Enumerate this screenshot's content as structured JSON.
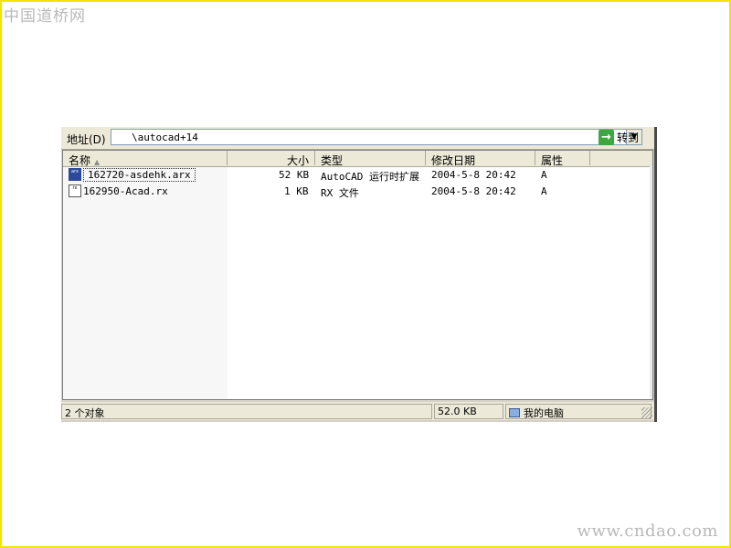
{
  "watermark": {
    "top": "中国道桥网",
    "bottom": "www.cndao.com"
  },
  "addressbar": {
    "label": "地址(D)",
    "path": "\\autocad+14",
    "go_label": "转到",
    "go_icon": "→",
    "dropdown_icon": "▼"
  },
  "columns": {
    "name": "名称",
    "size": "大小",
    "type": "类型",
    "modified": "修改日期",
    "attributes": "属性",
    "sort_indicator": "▲"
  },
  "files": [
    {
      "name": "162720-asdehk.arx",
      "size": "52 KB",
      "type": "AutoCAD 运行时扩展",
      "modified": "2004-5-8 20:42",
      "attr": "A",
      "icon_text": "arx"
    },
    {
      "name": "162950-Acad.rx",
      "size": "1 KB",
      "type": "RX 文件",
      "modified": "2004-5-8 20:42",
      "attr": "A",
      "icon_text": "rx"
    }
  ],
  "statusbar": {
    "objects": "2 个对象",
    "size": "52.0 KB",
    "location": "我的电脑"
  }
}
